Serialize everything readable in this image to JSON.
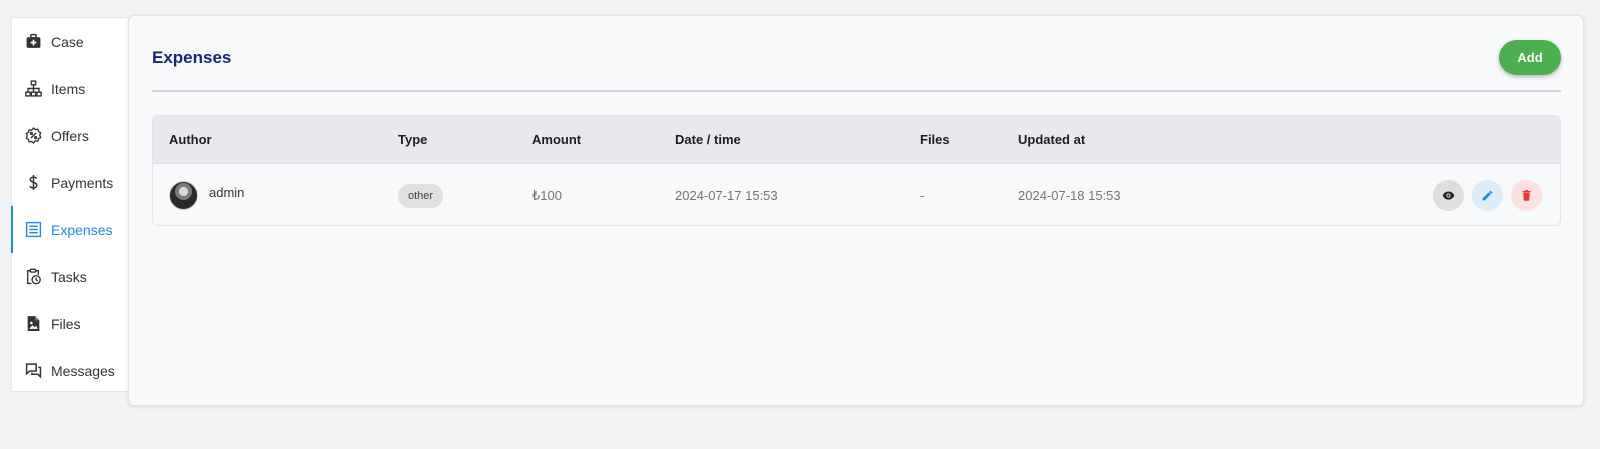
{
  "sidebar": {
    "items": [
      {
        "label": "Case",
        "icon": "briefcase-medical-icon",
        "active": false
      },
      {
        "label": "Items",
        "icon": "sitemap-icon",
        "active": false
      },
      {
        "label": "Offers",
        "icon": "badge-percent-icon",
        "active": false
      },
      {
        "label": "Payments",
        "icon": "dollar-icon",
        "active": false
      },
      {
        "label": "Expenses",
        "icon": "list-icon",
        "active": true
      },
      {
        "label": "Tasks",
        "icon": "clipboard-clock-icon",
        "active": false
      },
      {
        "label": "Files",
        "icon": "file-image-icon",
        "active": false
      },
      {
        "label": "Messages",
        "icon": "chat-bubbles-icon",
        "active": false
      }
    ],
    "active_color": "#1e88e5"
  },
  "main": {
    "title": "Expenses",
    "add_label": "Add",
    "add_color": "#4caf50"
  },
  "table": {
    "headers": [
      "Author",
      "Type",
      "Amount",
      "Date / time",
      "Files",
      "Updated at"
    ],
    "rows": [
      {
        "author": "admin",
        "type": "other",
        "amount": "₺100",
        "date_time": "2024-07-17 15:53",
        "files": "-",
        "updated_at": "2024-07-18 15:53",
        "actions": [
          "eye-icon",
          "pencil-icon",
          "trash-icon"
        ]
      }
    ]
  }
}
